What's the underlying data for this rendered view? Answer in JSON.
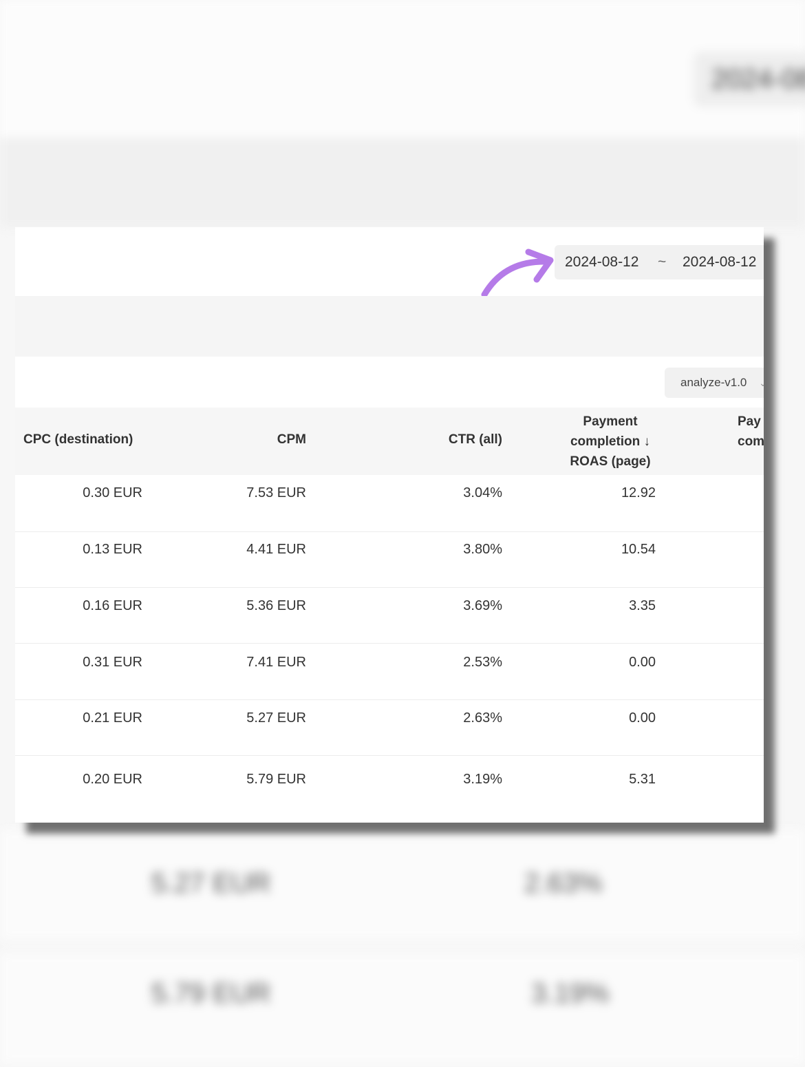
{
  "background": {
    "date_text": "2024-08",
    "rows": [
      {
        "cpm": "5.27 EUR",
        "ctr": "2.63%"
      },
      {
        "cpm": "5.79 EUR",
        "ctr": "3.19%"
      }
    ]
  },
  "date_range": {
    "start": "2024-08-12",
    "separator": "~",
    "end": "2024-08-12"
  },
  "version_select": {
    "value": "analyze-v1.0"
  },
  "table": {
    "headers": {
      "cpc": "CPC (destination)",
      "cpm": "CPM",
      "ctr": "CTR (all)",
      "roas_line1": "Payment",
      "roas_line2": "completion ↓",
      "roas_line3": "ROAS (page)",
      "next_line1": "Pay",
      "next_line2": "com"
    },
    "rows": [
      {
        "cpc": "0.30 EUR",
        "cpm": "7.53 EUR",
        "ctr": "3.04%",
        "roas": "12.92"
      },
      {
        "cpc": "0.13 EUR",
        "cpm": "4.41 EUR",
        "ctr": "3.80%",
        "roas": "10.54"
      },
      {
        "cpc": "0.16 EUR",
        "cpm": "5.36 EUR",
        "ctr": "3.69%",
        "roas": "3.35"
      },
      {
        "cpc": "0.31 EUR",
        "cpm": "7.41 EUR",
        "ctr": "2.53%",
        "roas": "0.00"
      },
      {
        "cpc": "0.21 EUR",
        "cpm": "5.27 EUR",
        "ctr": "2.63%",
        "roas": "0.00"
      },
      {
        "cpc": "0.20 EUR",
        "cpm": "5.79 EUR",
        "ctr": "3.19%",
        "roas": "5.31"
      }
    ]
  },
  "annotation": {
    "arrow_color": "#b57be8"
  }
}
